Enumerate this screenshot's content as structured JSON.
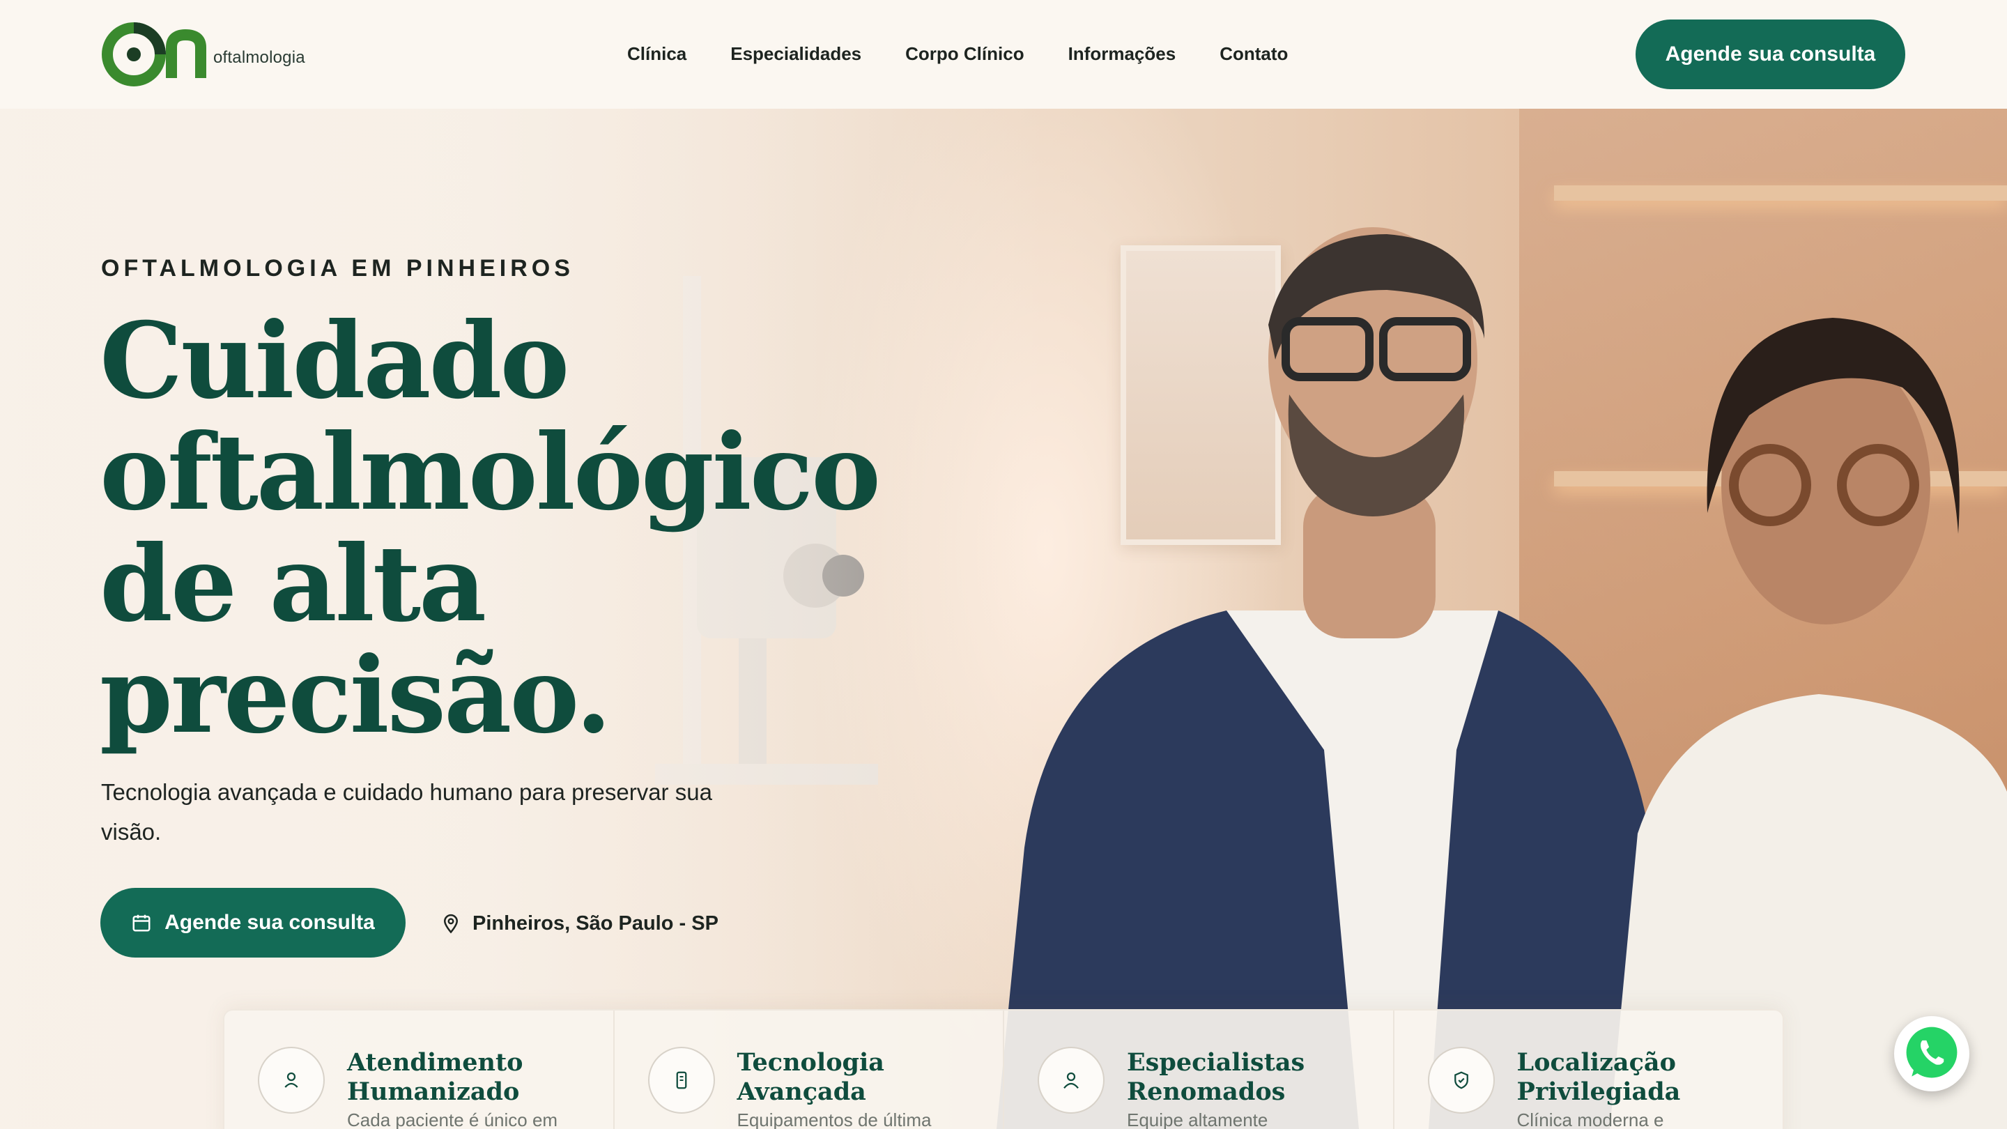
{
  "header": {
    "logo_text": "oftalmologia",
    "logo_mark": "On",
    "nav": [
      {
        "label": "Clínica"
      },
      {
        "label": "Especialidades"
      },
      {
        "label": "Corpo Clínico"
      },
      {
        "label": "Informações"
      },
      {
        "label": "Contato"
      }
    ],
    "cta_label": "Agende sua consulta"
  },
  "hero": {
    "eyebrow": "OFTALMOLOGIA EM PINHEIROS",
    "headline_lines": [
      "Cuidado",
      "oftalmológico",
      "de alta",
      "precisão."
    ],
    "subtitle": "Tecnologia avançada e cuidado humano para preservar sua visão.",
    "cta_label": "Agende sua consulta",
    "cta_icon": "calendar-icon",
    "location": "Pinheiros, São Paulo - SP",
    "location_icon": "map-pin-icon"
  },
  "features": [
    {
      "title": "Atendimento Humanizado",
      "desc": "Cada paciente é único em",
      "icon": "user-icon"
    },
    {
      "title": "Tecnologia Avançada",
      "desc": "Equipamentos de última",
      "icon": "device-icon"
    },
    {
      "title": "Especialistas Renomados",
      "desc": "Equipe altamente",
      "icon": "person-icon"
    },
    {
      "title": "Localização Privilegiada",
      "desc": "Clínica moderna e",
      "icon": "shield-check-icon"
    }
  ],
  "whatsapp": {
    "icon": "whatsapp-icon"
  },
  "colors": {
    "brand_green": "#136b56",
    "headline_green": "#0f4c3d",
    "logo_green": "#2e7d32",
    "background": "#f7efe6"
  }
}
